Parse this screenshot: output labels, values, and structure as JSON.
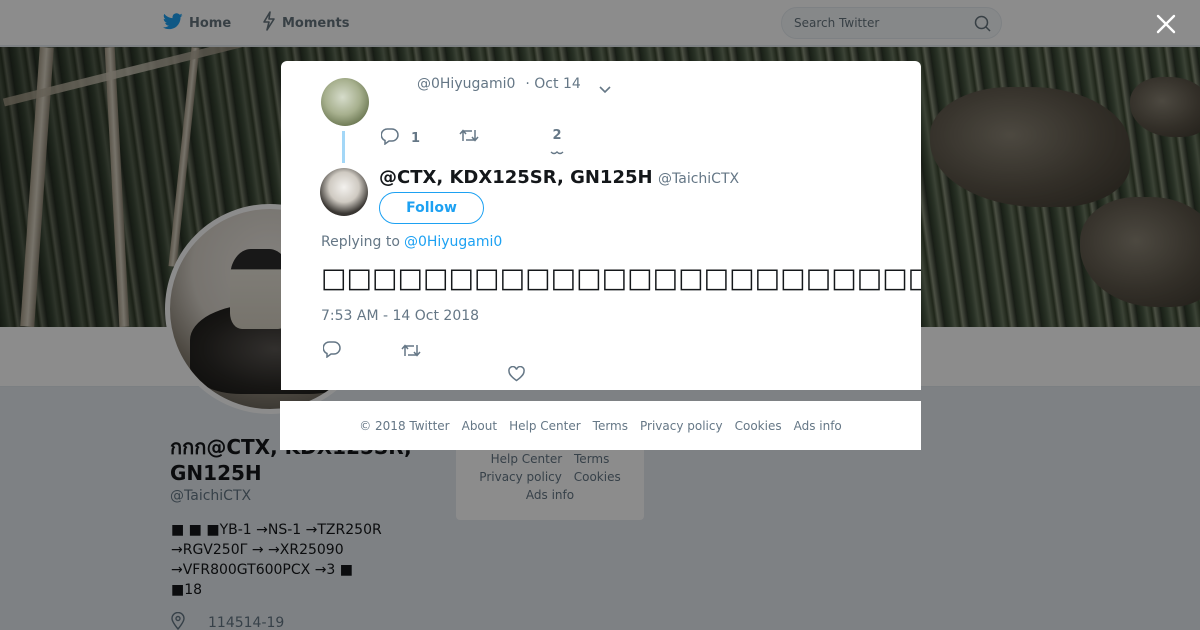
{
  "nav": {
    "home_label": "Home",
    "moments_label": "Moments",
    "search_placeholder": "Search Twitter"
  },
  "profile": {
    "name": "กกก@CTX, KDX125SR, GN125H",
    "handle": "@TaichiCTX",
    "bio": "■ ■ ■YB-1 →NS-1 →TZR250R\n→RGV250Γ → →XR25090\n→VFR800GT600PCX →3 ■\n ■18",
    "location": "114514-19"
  },
  "side_links": {
    "help_center": "Help Center",
    "terms": "Terms",
    "privacy": "Privacy policy",
    "cookies": "Cookies",
    "ads_info": "Ads info"
  },
  "modal": {
    "parent_tweet": {
      "handle": "@0Hiyugami0",
      "date": "· Oct 14",
      "reply_count": "1",
      "like_count": "2"
    },
    "tweet": {
      "author_name": "@CTX, KDX125SR, GN125H",
      "author_handle": "@TaichiCTX",
      "follow_label": "Follow",
      "replying_prefix": "Replying to",
      "replying_to": "@0Hiyugami0",
      "text": "□□□□□□□□□□□□□□□□□□□□□□□□□□□□□",
      "emoji": "grinning-face-emoji",
      "timestamp": "7:53 AM - 14 Oct 2018"
    }
  },
  "footer": {
    "copyright": "© 2018 Twitter",
    "about": "About",
    "help_center": "Help Center",
    "terms": "Terms",
    "privacy": "Privacy policy",
    "cookies": "Cookies",
    "ads_info": "Ads info"
  },
  "colors": {
    "accent": "#1da1f2",
    "muted_text": "#657786",
    "background": "#e6ecf0"
  }
}
